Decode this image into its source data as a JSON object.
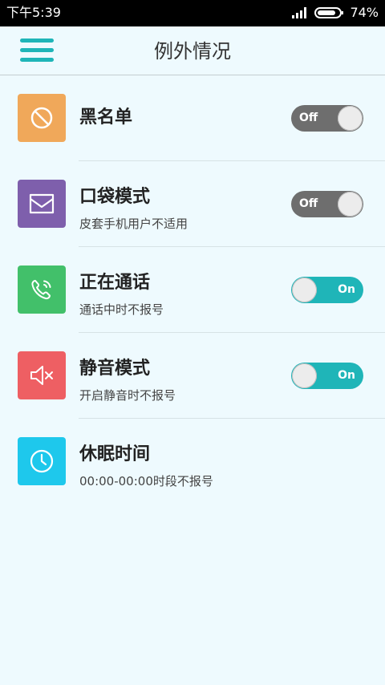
{
  "status_bar": {
    "time": "下午5:39",
    "battery": "74%"
  },
  "app_bar": {
    "title": "例外情况"
  },
  "items": [
    {
      "title": "黑名单",
      "subtitle": "",
      "toggle": "Off",
      "icon": "block-icon",
      "color": "#f0a85a"
    },
    {
      "title": "口袋模式",
      "subtitle": "皮套手机用户不适用",
      "toggle": "Off",
      "icon": "envelope-icon",
      "color": "#7e5fac"
    },
    {
      "title": "正在通话",
      "subtitle": "通话中时不报号",
      "toggle": "On",
      "icon": "phone-ringing-icon",
      "color": "#42c06a"
    },
    {
      "title": "静音模式",
      "subtitle": "开启静音时不报号",
      "toggle": "On",
      "icon": "speaker-mute-icon",
      "color": "#ee5f63"
    },
    {
      "title": "休眠时间",
      "subtitle": "00:00-00:00时段不报号",
      "icon": "clock-icon",
      "color": "#1ec8ec"
    }
  ],
  "colors": {
    "accent": "#1fb5b8",
    "background": "#eefafe",
    "toggle_off": "#6e6e6e"
  }
}
